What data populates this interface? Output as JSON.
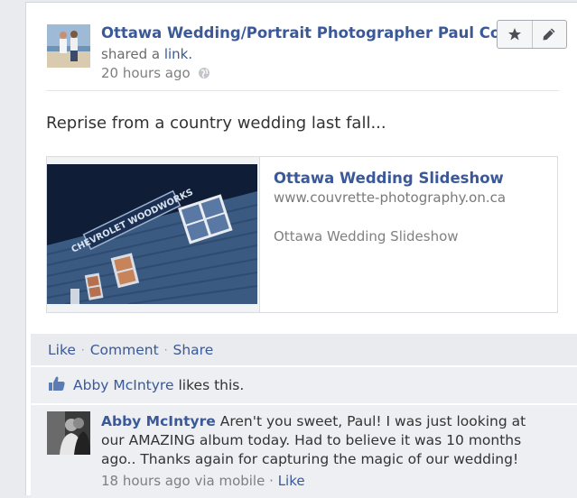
{
  "post": {
    "author": "Ottawa Wedding/Portrait Photographer Paul Couvrette",
    "action_prefix": "shared a",
    "action_link": "link.",
    "time": "20 hours ago",
    "privacy_icon": "globe-icon",
    "message": "Reprise from a country wedding last fall..."
  },
  "toolbar": {
    "star_icon": "star-icon",
    "edit_icon": "pencil-icon"
  },
  "attachment": {
    "title": "Ottawa Wedding Slideshow",
    "url": "www.couvrette-photography.on.ca",
    "description": "Ottawa Wedding Slideshow",
    "sign_text": "CHEVROLET WOODWORKS"
  },
  "ufi": {
    "like": "Like",
    "comment": "Comment",
    "share": "Share",
    "separator": "·"
  },
  "likes": {
    "name": "Abby McIntyre",
    "suffix": "likes this."
  },
  "comment": {
    "author": "Abby McIntyre",
    "text": "Aren't you sweet, Paul! I was just looking at our AMAZING album today. Had to believe it was 10 months ago.. Thanks again for capturing the magic of our wedding!",
    "time": "18 hours ago via mobile",
    "separator": "·",
    "like": "Like"
  },
  "colors": {
    "link": "#3b5998",
    "ufi_bg": "#e9ebee",
    "text": "#333333",
    "muted": "#7f7f7f"
  }
}
